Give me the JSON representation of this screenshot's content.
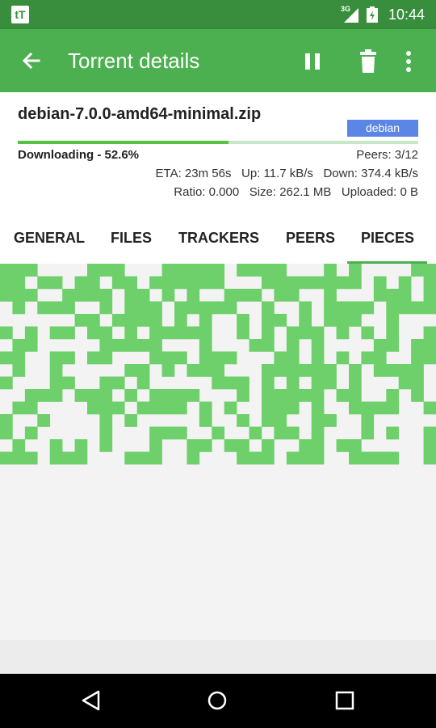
{
  "status_bar": {
    "app_icon_text": "tT",
    "network_type": "3G",
    "time": "10:44"
  },
  "app_bar": {
    "title": "Torrent details",
    "icons": [
      "back-arrow-icon",
      "pause-icon",
      "trash-icon",
      "more-vert-icon"
    ]
  },
  "torrent": {
    "name": "debian-7.0.0-amd64-minimal.zip",
    "label": "debian",
    "progress_percent": 52.6,
    "status": "Downloading - 52.6%",
    "peers": "Peers: 3/12",
    "eta": "ETA: 23m 56s",
    "up": "Up: 11.7 kB/s",
    "down": "Down: 374.4 kB/s",
    "ratio": "Ratio: 0.000",
    "size": "Size: 262.1 MB",
    "uploaded": "Uploaded: 0 B"
  },
  "tabs": [
    {
      "label": "GENERAL",
      "selected": false
    },
    {
      "label": "FILES",
      "selected": false
    },
    {
      "label": "TRACKERS",
      "selected": false
    },
    {
      "label": "PEERS",
      "selected": false
    },
    {
      "label": "PIECES",
      "selected": true
    }
  ],
  "pieces": {
    "columns": 35,
    "done_color": "#6ed06a",
    "missing_color": "#f3f3f3",
    "rows": [
      "11100001110001111101111000101000011",
      "11011011011011111100011111111010101",
      "11100111101101010011101100100011101",
      "01011100101110111110010010111101111",
      "00000011011110101001011010111001000",
      "10101101101011111001010111010101001",
      "01100000111110001000110101000011011",
      "11001101100011101110001101010110011",
      "01001000001101011100011111101011110",
      "10001100110100000111010101101000110",
      "00111011101011110001011111011001010",
      "01100001110111101010011101001111001",
      "10010000101000001001011001100100000",
      "10100000100011100100101101000101001",
      "01001010100010011011010011011000001",
      "11101110001110010001110111001111001"
    ]
  },
  "nav_bar": {
    "icons": [
      "nav-back-icon",
      "nav-home-icon",
      "nav-recents-icon"
    ]
  }
}
